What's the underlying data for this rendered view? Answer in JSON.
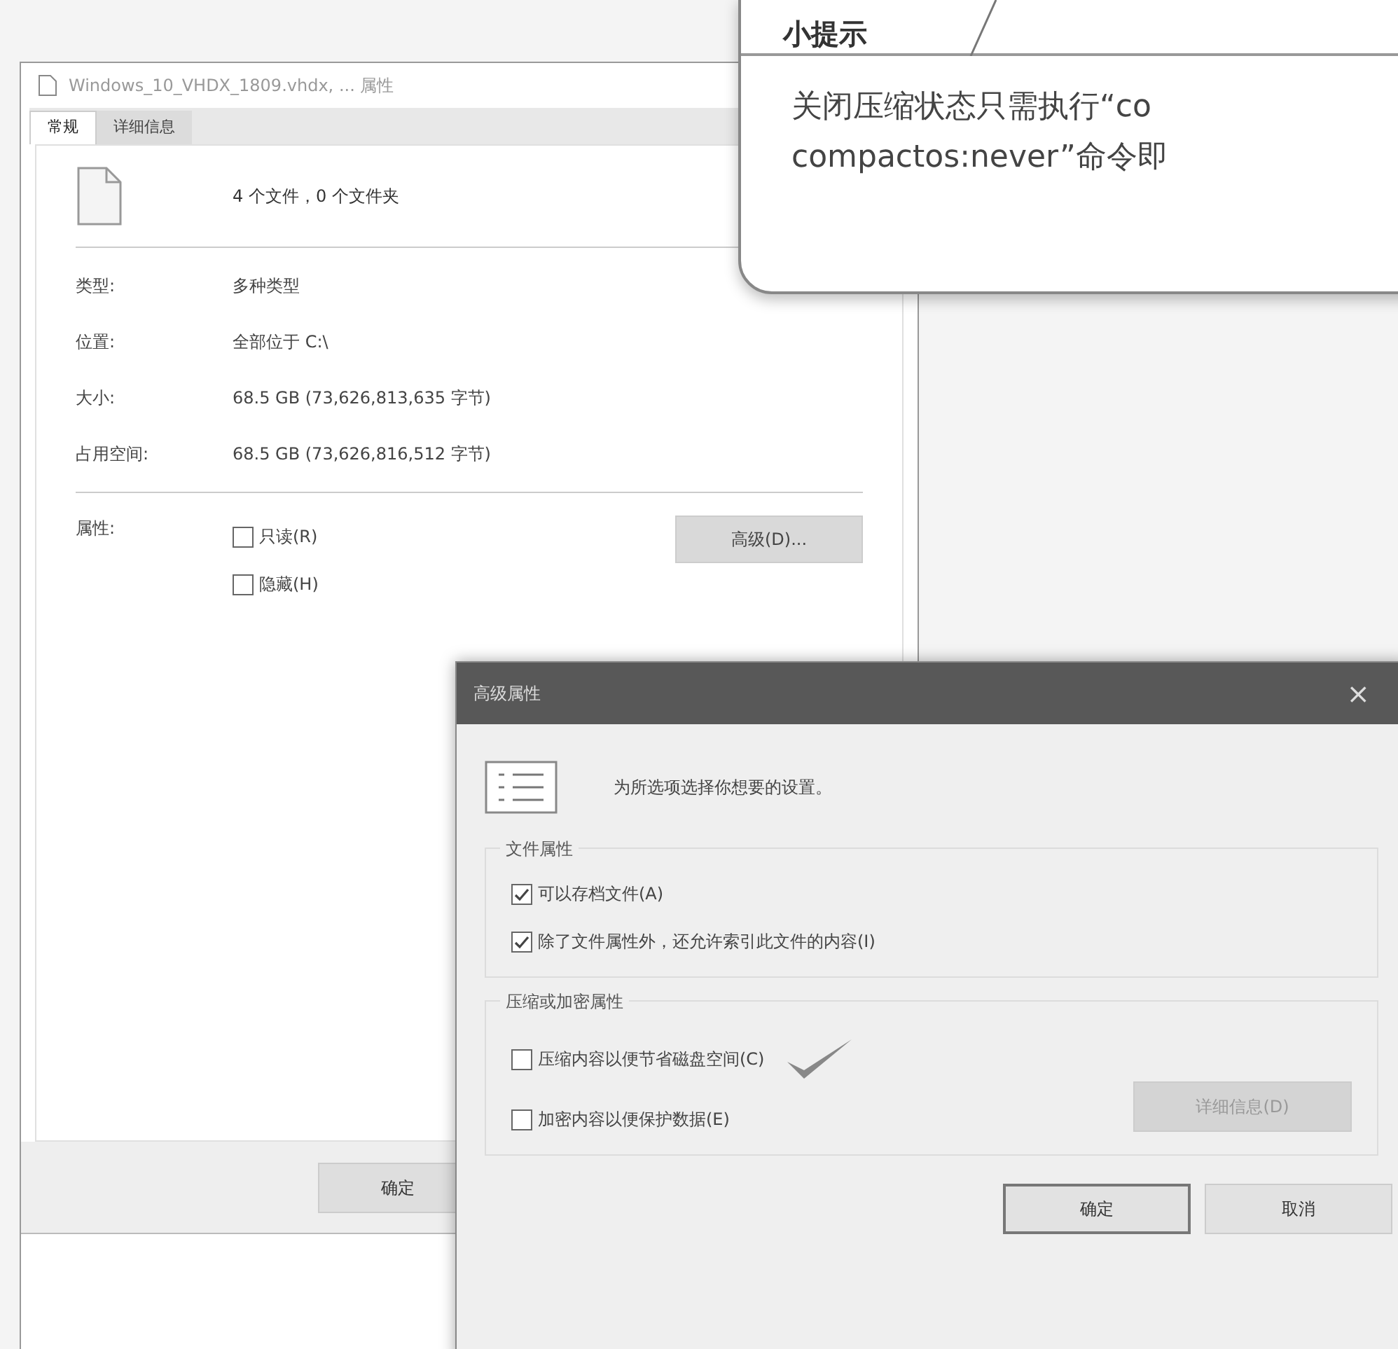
{
  "tip": {
    "title": "小提示",
    "lines": [
      "关闭压缩状态只需执行“co",
      "compactos:never”命令即"
    ]
  },
  "properties_window": {
    "title": "Windows_10_VHDX_1809.vhdx, ... 属性",
    "tabs": [
      {
        "label": "常规",
        "selected": true
      },
      {
        "label": "详细信息",
        "selected": false
      }
    ],
    "summary": "4 个文件，0 个文件夹",
    "fields": [
      {
        "label": "类型:",
        "value": "多种类型"
      },
      {
        "label": "位置:",
        "value": "全部位于 C:\\"
      },
      {
        "label": "大小:",
        "value": "68.5 GB (73,626,813,635 字节)"
      },
      {
        "label": "占用空间:",
        "value": "68.5 GB (73,626,816,512 字节)"
      }
    ],
    "attributes_label": "属性:",
    "attributes": [
      {
        "label": "只读(R)",
        "checked": false
      },
      {
        "label": "隐藏(H)",
        "checked": false
      }
    ],
    "advanced_button": "高级(D)...",
    "ok_button": "确定"
  },
  "advanced_dialog": {
    "title": "高级属性",
    "close": "×",
    "intro": "为所选项选择你想要的设置。",
    "groups": [
      {
        "title": "文件属性",
        "options": [
          {
            "label": "可以存档文件(A)",
            "checked": true
          },
          {
            "label": "除了文件属性外，还允许索引此文件的内容(I)",
            "checked": true
          }
        ]
      },
      {
        "title": "压缩或加密属性",
        "options": [
          {
            "label": "压缩内容以便节省磁盘空间(C)",
            "checked": false
          },
          {
            "label": "加密内容以便保护数据(E)",
            "checked": false
          }
        ],
        "details_button": {
          "label": "详细信息(D)",
          "disabled": true
        }
      }
    ],
    "ok_button": "确定",
    "cancel_button": "取消"
  }
}
